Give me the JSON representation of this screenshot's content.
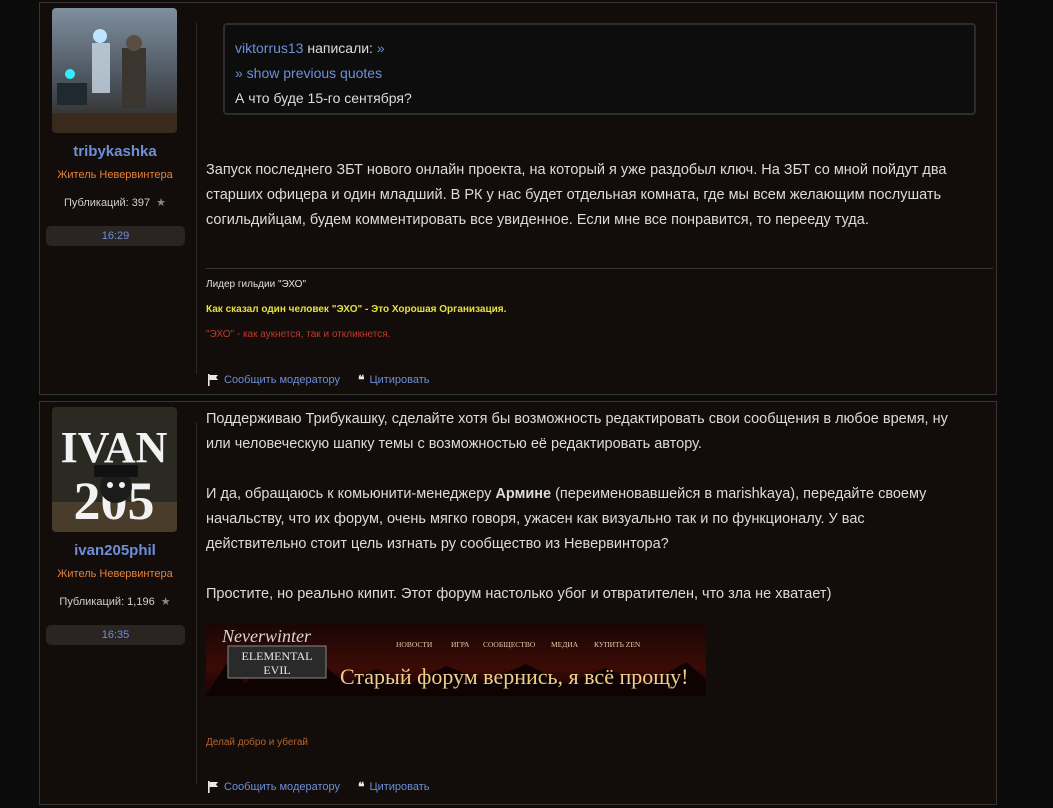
{
  "posts": [
    {
      "author": {
        "username": "tribykashka",
        "rank": "Житель Невервинтера",
        "post_count_label": "Публикаций: 397",
        "time": "16:29"
      },
      "quote": {
        "author": "viktorrus13",
        "said": " написали:",
        "arrow": " »",
        "show_prev": "» show previous quotes",
        "text": "А что буде 15-го сентября?"
      },
      "body": [
        "Запуск последнего ЗБТ нового онлайн проекта, на который я уже раздобыл ключ. На ЗБТ со мной пойдут два",
        "старших офицера и один младший. В РК у нас будет отдельная комната, где мы всем желающим послушать",
        "согильдийцам, будем комментировать все увиденное. Если мне все понравится, то перееду туда."
      ],
      "signature": {
        "line1": "Лидер гильдии \"ЭХО\"",
        "line2": "Как сказал один человек \"ЭХО\" - Это Хорошая Организация.",
        "line3": "\"ЭХО\" - как аукнется, так и откликнется."
      },
      "actions": {
        "report": "Сообщить модератору",
        "quote": "Цитировать"
      }
    },
    {
      "author": {
        "username": "ivan205phil",
        "rank": "Житель Невервинтера",
        "post_count_label": "Публикаций: 1,196",
        "time": "16:35"
      },
      "body_p1": [
        "Поддерживаю Трибукашку, сделайте хотя бы возможность редактировать свои сообщения в любое время, ну",
        "или человеческую шапку темы с возможностью её редактировать автору."
      ],
      "body_p2_prefix": "И да, обращаюсь к комьюнити-менеджеру ",
      "body_p2_bold": "Армине",
      "body_p2_suffix": " (переименовавшейся в marishkaya), передайте своему",
      "body_p2_rest": [
        "начальству, что их форум, очень мягко говоря, ужасен как визуально так и по функционалу. У вас",
        "действительно стоит цель изгнать ру сообщество из Невервинтора?"
      ],
      "body_p3": "Простите, но реально кипит. Этот форум настолько убог и отвратителен, что зла не хватает)",
      "banner": {
        "logo": "Neverwinter",
        "sub1": "ELEMENTAL",
        "sub2": "EVIL",
        "nav": [
          "НОВОСТИ",
          "ИГРА",
          "СООБЩЕСТВО",
          "МЕДИА",
          "КУПИТЬ ZEN"
        ],
        "caption": "Старый форум вернись, я всё прощу!"
      },
      "signature": "Делай добро и убегай",
      "actions": {
        "report": "Сообщить модератору",
        "quote": "Цитировать"
      }
    }
  ],
  "icons": {
    "star": "star-icon",
    "flag": "flag-icon",
    "quote": "quote-icon"
  },
  "colors": {
    "link": "#6d8fd8",
    "rank": "#e5823a",
    "sig_yellow": "#e6e23a",
    "sig_red": "#c0392b",
    "sig_orange": "#b5652e"
  }
}
